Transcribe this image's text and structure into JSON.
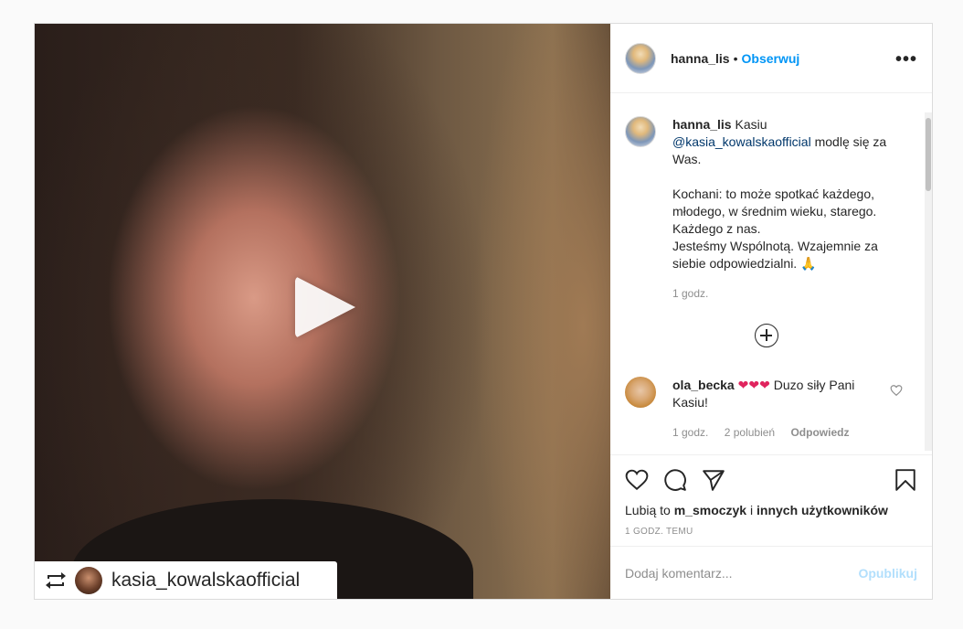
{
  "media": {
    "play_icon": "play-icon",
    "repost_icon": "repost-icon",
    "repost_username": "kasia_kowalskaofficial"
  },
  "header": {
    "username": "hanna_lis",
    "separator": "•",
    "follow_label": "Obserwuj",
    "more_label": "•••"
  },
  "caption": {
    "username": "hanna_lis",
    "text_1": " Kasiu ",
    "mention": "@kasia_kowalskaofficial",
    "text_2": " modlę się za Was.",
    "paragraph_1": "Kochani: to może spotkać każdego, młodego, w średnim wieku, starego. Każdego z nas.",
    "paragraph_2": "Jesteśmy Wspólnotą. Wzajemnie za siebie odpowiedzialni. 🙏",
    "time": "1 godz."
  },
  "comment": {
    "username": "ola_becka",
    "hearts": "❤❤❤",
    "text": " Duzo siły Pani Kasiu!",
    "time": "1 godz.",
    "likes": "2 polubień",
    "reply": "Odpowiedz"
  },
  "actions": {
    "likes_prefix": "Lubią to ",
    "likes_user": "m_smoczyk",
    "likes_mid": " i ",
    "likes_others": "innych użytkowników",
    "timestamp": "1 GODZ. TEMU"
  },
  "add_comment": {
    "placeholder": "Dodaj komentarz...",
    "publish_label": "Opublikuj"
  },
  "colors": {
    "accent": "#0095f6",
    "heart": "#e0245e",
    "publish_disabled": "#b2dffc"
  }
}
